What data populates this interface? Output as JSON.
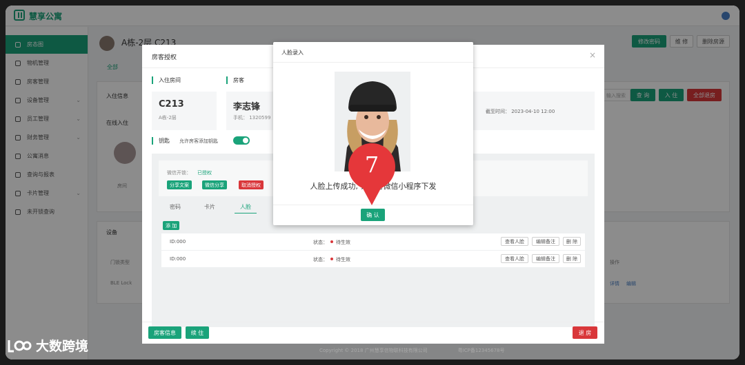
{
  "brand": "慧享公寓",
  "sidebar": {
    "items": [
      {
        "label": "房态图",
        "active": true,
        "caret": ""
      },
      {
        "label": "物机管理",
        "active": false,
        "caret": ""
      },
      {
        "label": "房客管理",
        "active": false,
        "caret": ""
      },
      {
        "label": "设备管理",
        "active": false,
        "caret": "⌄"
      },
      {
        "label": "员工管理",
        "active": false,
        "caret": "⌄"
      },
      {
        "label": "财务管理",
        "active": false,
        "caret": "⌄"
      },
      {
        "label": "公寓消息",
        "active": false,
        "caret": ""
      },
      {
        "label": "查询与报表",
        "active": false,
        "caret": ""
      },
      {
        "label": "卡片管理",
        "active": false,
        "caret": "⌄"
      },
      {
        "label": "未开锁查询",
        "active": false,
        "caret": ""
      }
    ]
  },
  "page": {
    "title": "A栋-2层  C213",
    "tab_all": "全部",
    "btn_change_password": "修改密码",
    "btn_repair": "维 修",
    "btn_delete_room": "删除房源",
    "section_checkin": "入住信息",
    "online_checkin": "在线入住",
    "search_placeholder": "输入搜索",
    "btn_query": "查 询",
    "btn_checkin": "入 住",
    "btn_all_checkout": "全部退房",
    "section_device": "设备",
    "device_type_label": "门锁类型",
    "device_type_value": "BLE Lock",
    "col_action": "操作",
    "action_detail": "详情",
    "action_edit": "编辑",
    "avatar_label": "房间",
    "copyright": "Copyright © 2018 广州慧享信物联科技有限公司",
    "icp": "粤ICP备12345678号"
  },
  "auth_dialog": {
    "title": "房客授权",
    "close": "×",
    "label_room": "入住房间",
    "label_tenant": "房客",
    "room_number": "C213",
    "room_floor": "A栋-2层",
    "tenant_name": "李志锋",
    "tenant_phone": "手机： 1320599",
    "end_time": "截至时间：  2023-04-10 12:00",
    "label_key": "钥匙",
    "allow_add_key": "允许房客添加钥匙",
    "wechat_status_label": "微信开锁：",
    "wechat_status_value": "已授权",
    "tag_share_text": "分享文案",
    "tag_wechat_share": "微信分享",
    "tag_cancel_auth": "取消授权",
    "tabs": [
      "密码",
      "卡片",
      "人脸"
    ],
    "btn_add": "添 加",
    "rows": [
      {
        "id": "ID:000",
        "status_label": "状态：",
        "status": "待生效",
        "btn_view": "查看人脸",
        "btn_note": "编辑备注",
        "btn_delete": "删 除"
      },
      {
        "id": "ID:000",
        "status_label": "状态：",
        "status": "待生效",
        "btn_view": "查看人脸",
        "btn_note": "编辑备注",
        "btn_delete": "删 除"
      }
    ],
    "btn_tenant_info": "房客信息",
    "btn_renew": "续 住",
    "btn_checkout": "退 房"
  },
  "face_dialog": {
    "title": "人脸录入",
    "message": "人脸上传成功,  请等待微信小程序下发",
    "confirm": "确 认"
  },
  "step_marker": "7",
  "watermark": "大数跨境",
  "colors": {
    "accent": "#1aa37a",
    "danger": "#d9373a",
    "marker": "#e5373a"
  }
}
